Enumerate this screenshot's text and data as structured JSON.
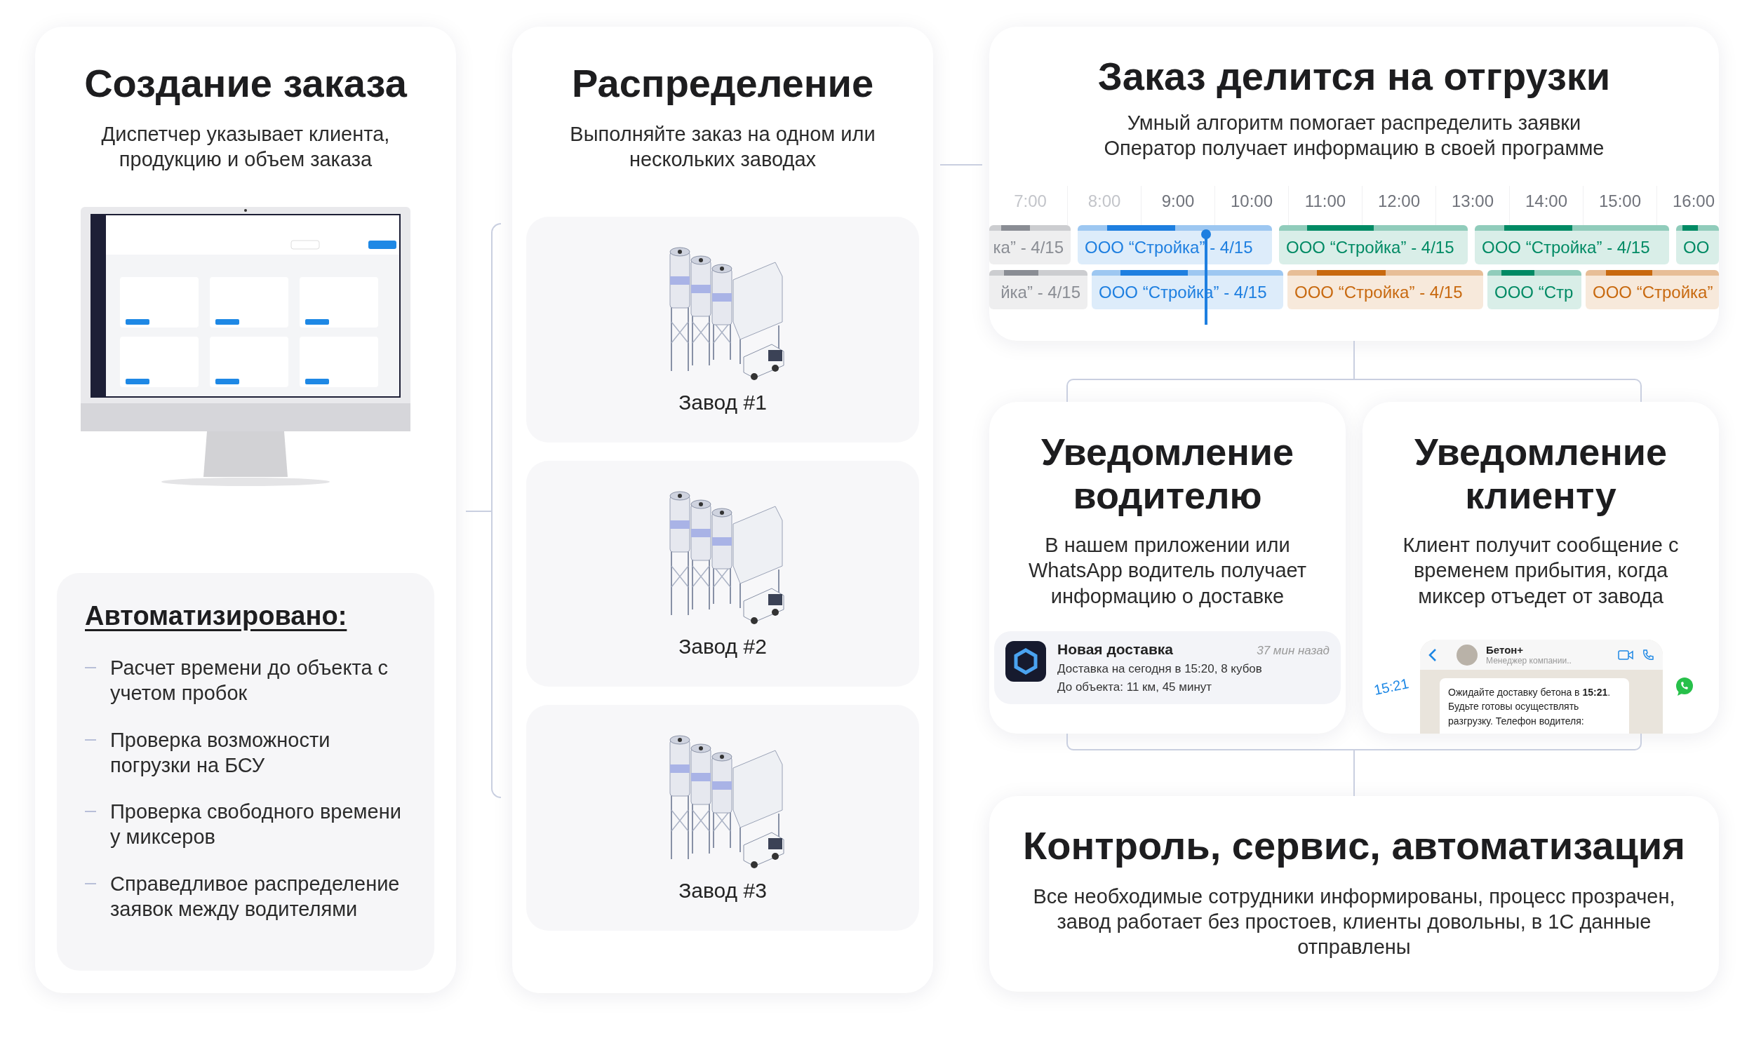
{
  "order": {
    "title": "Создание заказа",
    "subtitle": "Диспетчер указывает клиента, продукцию и объем заказа",
    "automated": {
      "title": "Автоматизировано:",
      "items": [
        "Расчет времени до объекта с учетом пробок",
        "Проверка возможности погрузки на БСУ",
        "Проверка свободного времени у миксеров",
        "Справедливое распределение заявок между водителями"
      ]
    }
  },
  "distribution": {
    "title": "Распределение",
    "subtitle": "Выполняйте заказ на одном или нескольких заводах",
    "plants": [
      {
        "label": "Завод #1"
      },
      {
        "label": "Завод #2"
      },
      {
        "label": "Завод #3"
      }
    ]
  },
  "split": {
    "title": "Заказ делится на отгрузки",
    "subtitle_lines": [
      "Умный алгоритм помогает распределить заявки",
      "Оператор получает информацию в своей программе"
    ],
    "timeline": {
      "hours": [
        {
          "label": "7:00",
          "dimmed": true
        },
        {
          "label": "8:00",
          "dimmed": true
        },
        {
          "label": "9:00",
          "dimmed": false
        },
        {
          "label": "10:00",
          "dimmed": false
        },
        {
          "label": "11:00",
          "dimmed": false
        },
        {
          "label": "12:00",
          "dimmed": false
        },
        {
          "label": "13:00",
          "dimmed": false
        },
        {
          "label": "14:00",
          "dimmed": false
        },
        {
          "label": "15:00",
          "dimmed": false
        },
        {
          "label": "16:00",
          "dimmed": false
        }
      ],
      "rows": [
        [
          {
            "text": "ка” - 4/15",
            "color": "#8a8d94"
          },
          {
            "text": "ООО “Стройка” - 4/15",
            "color": "#1e7fe0"
          },
          {
            "text": "ООО “Стройка” - 4/15",
            "color": "#008a64"
          },
          {
            "text": "ООО “Стройка” - 4/15",
            "color": "#008a64"
          },
          {
            "text": "ОО",
            "color": "#008a64"
          }
        ],
        [
          {
            "text": "йка” - 4/15",
            "color": "#8a8d94"
          },
          {
            "text": "ООО “Стройка” - 4/15",
            "color": "#1e7fe0"
          },
          {
            "text": "ООО “Стройка” - 4/15",
            "color": "#c8690f"
          },
          {
            "text": "ООО “Стр",
            "color": "#008a64"
          },
          {
            "text": "ООО “Стройка”",
            "color": "#c8690f"
          }
        ]
      ]
    }
  },
  "driver_notice": {
    "title": "Уведомление водителю",
    "text": "В нашем приложении или WhatsApp водитель получает информацию о доставке",
    "notification": {
      "title": "Новая доставка",
      "time": "37 мин назад",
      "lines": [
        "Доставка на сегодня в 15:20, 8 кубов",
        "До объекта: 11 км, 45 минут"
      ]
    }
  },
  "client_notice": {
    "title": "Уведомление клиенту",
    "text": "Клиент получит сообщение с временем прибытия, когда миксер отъедет от завода",
    "chat": {
      "contact": "Бетон+",
      "status": "Менеджер компании..",
      "time": "15:21",
      "message": "Ожидайте доставку бетона в **15:21**. Будьте готовы осуществлять разгрузку. Телефон водителя:"
    }
  },
  "summary": {
    "title": "Контроль, сервис, автоматизация",
    "text": "Все необходимые сотрудники информированы, процесс прозрачен, завод работает без простоев, клиенты довольны, в 1С данные отправлены"
  }
}
